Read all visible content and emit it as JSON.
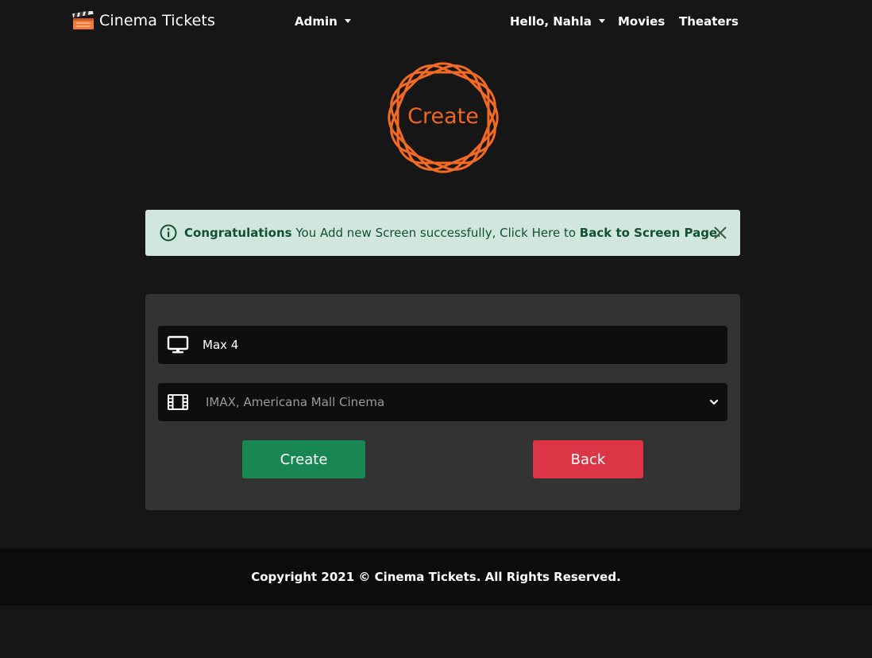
{
  "navbar": {
    "brand": "Cinema Tickets",
    "admin_label": "Admin",
    "user_greeting": "Hello, Nahla",
    "movies_label": "Movies",
    "theaters_label": "Theaters"
  },
  "emblem": {
    "label": "Create",
    "color": "#f2651f"
  },
  "alert": {
    "strong": "Congratulations",
    "message": " You Add new Screen successfully, Click Here to ",
    "link": "Back to Screen Page",
    "end": "."
  },
  "form": {
    "screen_name_value": "Max 4",
    "theater_selected": "IMAX, Americana Mall Cinema",
    "create_label": "Create",
    "back_label": "Back"
  },
  "footer": {
    "copyright": "Copyright 2021 © Cinema Tickets. All Rights Reserved."
  },
  "colors": {
    "background": "#161616",
    "card": "#333333",
    "create_button": "#198754",
    "back_button": "#dc3545",
    "alert_bg": "#d1e7dd",
    "alert_text": "#0f5132"
  },
  "icons": {
    "brand": "clapperboard-icon",
    "alert": "info-circle-icon",
    "close": "close-icon",
    "screen_field": "monitor-icon",
    "theater_field": "film-icon",
    "select": "chevron-down-icon"
  }
}
